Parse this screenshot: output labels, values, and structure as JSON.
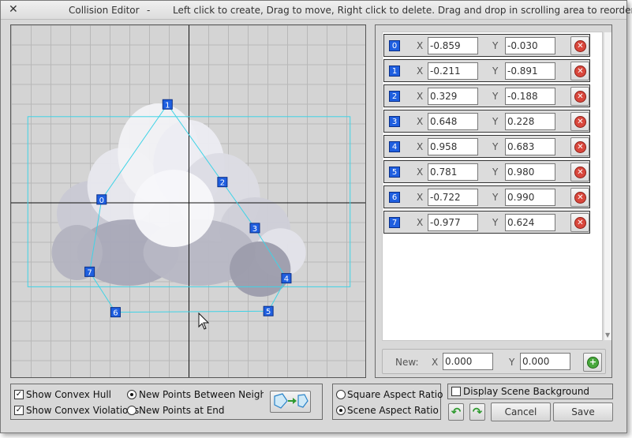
{
  "window": {
    "title": "Collision Editor",
    "separator": "-",
    "instructions": "Left click to create, Drag to move, Right click to delete. Drag and drop in scrolling area to reorder.",
    "close_glyph": "✕"
  },
  "canvas": {
    "range": {
      "x": [
        -1.75,
        1.75
      ],
      "y": [
        -1.6,
        1.6
      ]
    },
    "bbox": {
      "x": [
        -1.585,
        1.585
      ],
      "y": [
        -0.78,
        0.76
      ]
    }
  },
  "points": [
    {
      "index": "0",
      "x": "-0.859",
      "y": "-0.030"
    },
    {
      "index": "1",
      "x": "-0.211",
      "y": "-0.891"
    },
    {
      "index": "2",
      "x": "0.329",
      "y": "-0.188"
    },
    {
      "index": "3",
      "x": "0.648",
      "y": "0.228"
    },
    {
      "index": "4",
      "x": "0.958",
      "y": "0.683"
    },
    {
      "index": "5",
      "x": "0.781",
      "y": "0.980"
    },
    {
      "index": "6",
      "x": "-0.722",
      "y": "0.990"
    },
    {
      "index": "7",
      "x": "-0.977",
      "y": "0.624"
    }
  ],
  "labels": {
    "x": "X",
    "y": "Y"
  },
  "new_point": {
    "label": "New:",
    "x": "0.000",
    "y": "0.000"
  },
  "options": {
    "show_convex_hull": "Show Convex Hull",
    "show_convex_violations": "Show Convex Violations",
    "new_between": "New Points Between Neighbors",
    "new_at_end": "New Points at End",
    "square_aspect": "Square Aspect Ratio",
    "scene_aspect": "Scene Aspect Ratio",
    "display_background": "Display Scene Background"
  },
  "state": {
    "show_convex_hull": true,
    "show_convex_violations": true,
    "new_mode": "between",
    "aspect": "scene",
    "display_background": false
  },
  "buttons": {
    "cancel": "Cancel",
    "save": "Save",
    "undo": "↶",
    "redo": "↷"
  },
  "colors": {
    "hull": "#3fd3e6",
    "point_marker": "#1f5fe0",
    "delete": "#d9473c",
    "add": "#48a83c",
    "undo_redo": "#2f9a2f"
  }
}
